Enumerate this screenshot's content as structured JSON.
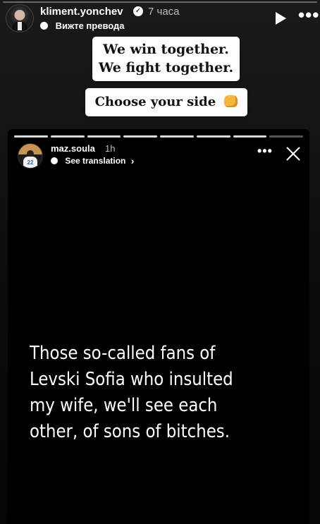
{
  "outer_story": {
    "username": "kliment.yonchev",
    "verified_icon": "verified-badge",
    "time": "7 часа",
    "translation_label": "Вижте превода",
    "controls": {
      "play_icon": "play-icon",
      "more_icon": "more-icon"
    }
  },
  "stickers": {
    "line1": "We win together.",
    "line2": "We fight together.",
    "choose_side": "Choose your side",
    "emoji_icon": "fist-bump-icon"
  },
  "inner_story": {
    "username": "maz.soula",
    "time": "1h",
    "translation_label": "See translation",
    "avatar_jersey_number": "22",
    "controls": {
      "more_icon": "more-icon",
      "close_icon": "close-icon"
    },
    "progress": {
      "segments": 8,
      "active_segment": 7
    },
    "text": "Those so-called fans of Levski Sofia who insulted my wife, we'll see each other, of sons of bitches."
  },
  "colors": {
    "background": "#0b0b0b",
    "card": "#000000",
    "text": "#ffffff",
    "secondary_text": "#bdbdbd",
    "sticker_bg": "#ffffff"
  }
}
